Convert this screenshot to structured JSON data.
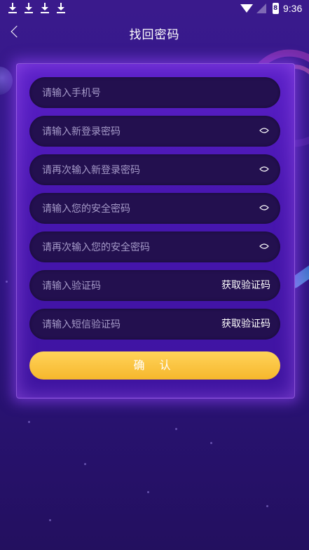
{
  "status_bar": {
    "time": "9:36",
    "battery_label": "8",
    "icons": [
      "download-icon",
      "download-icon",
      "download-icon",
      "download-icon",
      "wifi-icon",
      "signal-icon",
      "battery-icon"
    ]
  },
  "header": {
    "title": "找回密码",
    "back_icon": "back-arrow-icon"
  },
  "form": {
    "phone_placeholder": "请输入手机号",
    "new_password_placeholder": "请输入新登录密码",
    "confirm_new_password_placeholder": "请再次输入新登录密码",
    "security_password_placeholder": "请输入您的安全密码",
    "confirm_security_password_placeholder": "请再次输入您的安全密码",
    "verify_code_placeholder": "请输入验证码",
    "verify_code_button": "获取验证码",
    "sms_code_placeholder": "请输入短信验证码",
    "sms_code_button": "获取验证码",
    "confirm_button": "确 认"
  },
  "colors": {
    "background": "#2b137a",
    "card": "#4816b0",
    "field": "#23104f",
    "accent": "#f6b72c"
  }
}
